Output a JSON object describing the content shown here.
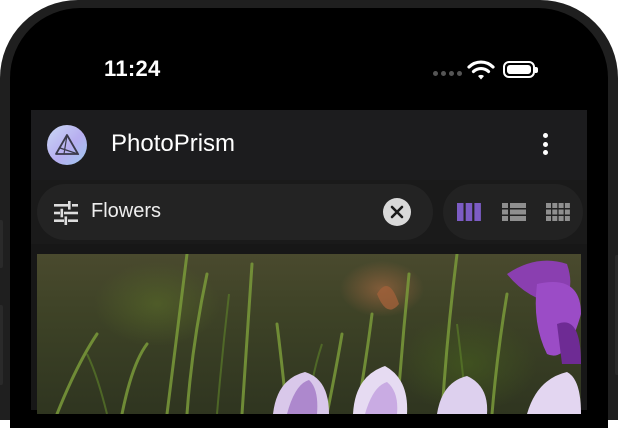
{
  "status_bar": {
    "time": "11:24",
    "icons": [
      "cellular-dots-icon",
      "wifi-icon",
      "battery-icon"
    ]
  },
  "app": {
    "title": "PhotoPrism",
    "logo_icon": "photoprism-logo-icon",
    "menu_icon": "more-vertical-icon"
  },
  "search": {
    "filter_icon": "tune-sliders-icon",
    "value": "Flowers",
    "clear_icon": "close-circle-icon"
  },
  "view_modes": [
    {
      "name": "cards",
      "icon": "view-column-icon",
      "active": true
    },
    {
      "name": "list",
      "icon": "view-list-icon",
      "active": false
    },
    {
      "name": "mosaic",
      "icon": "view-grid-icon",
      "active": false
    }
  ],
  "colors": {
    "accent": "#7c5cc4",
    "background": "#171717",
    "header": "#1c1c1e",
    "icon_inactive": "#8f8f8f"
  }
}
